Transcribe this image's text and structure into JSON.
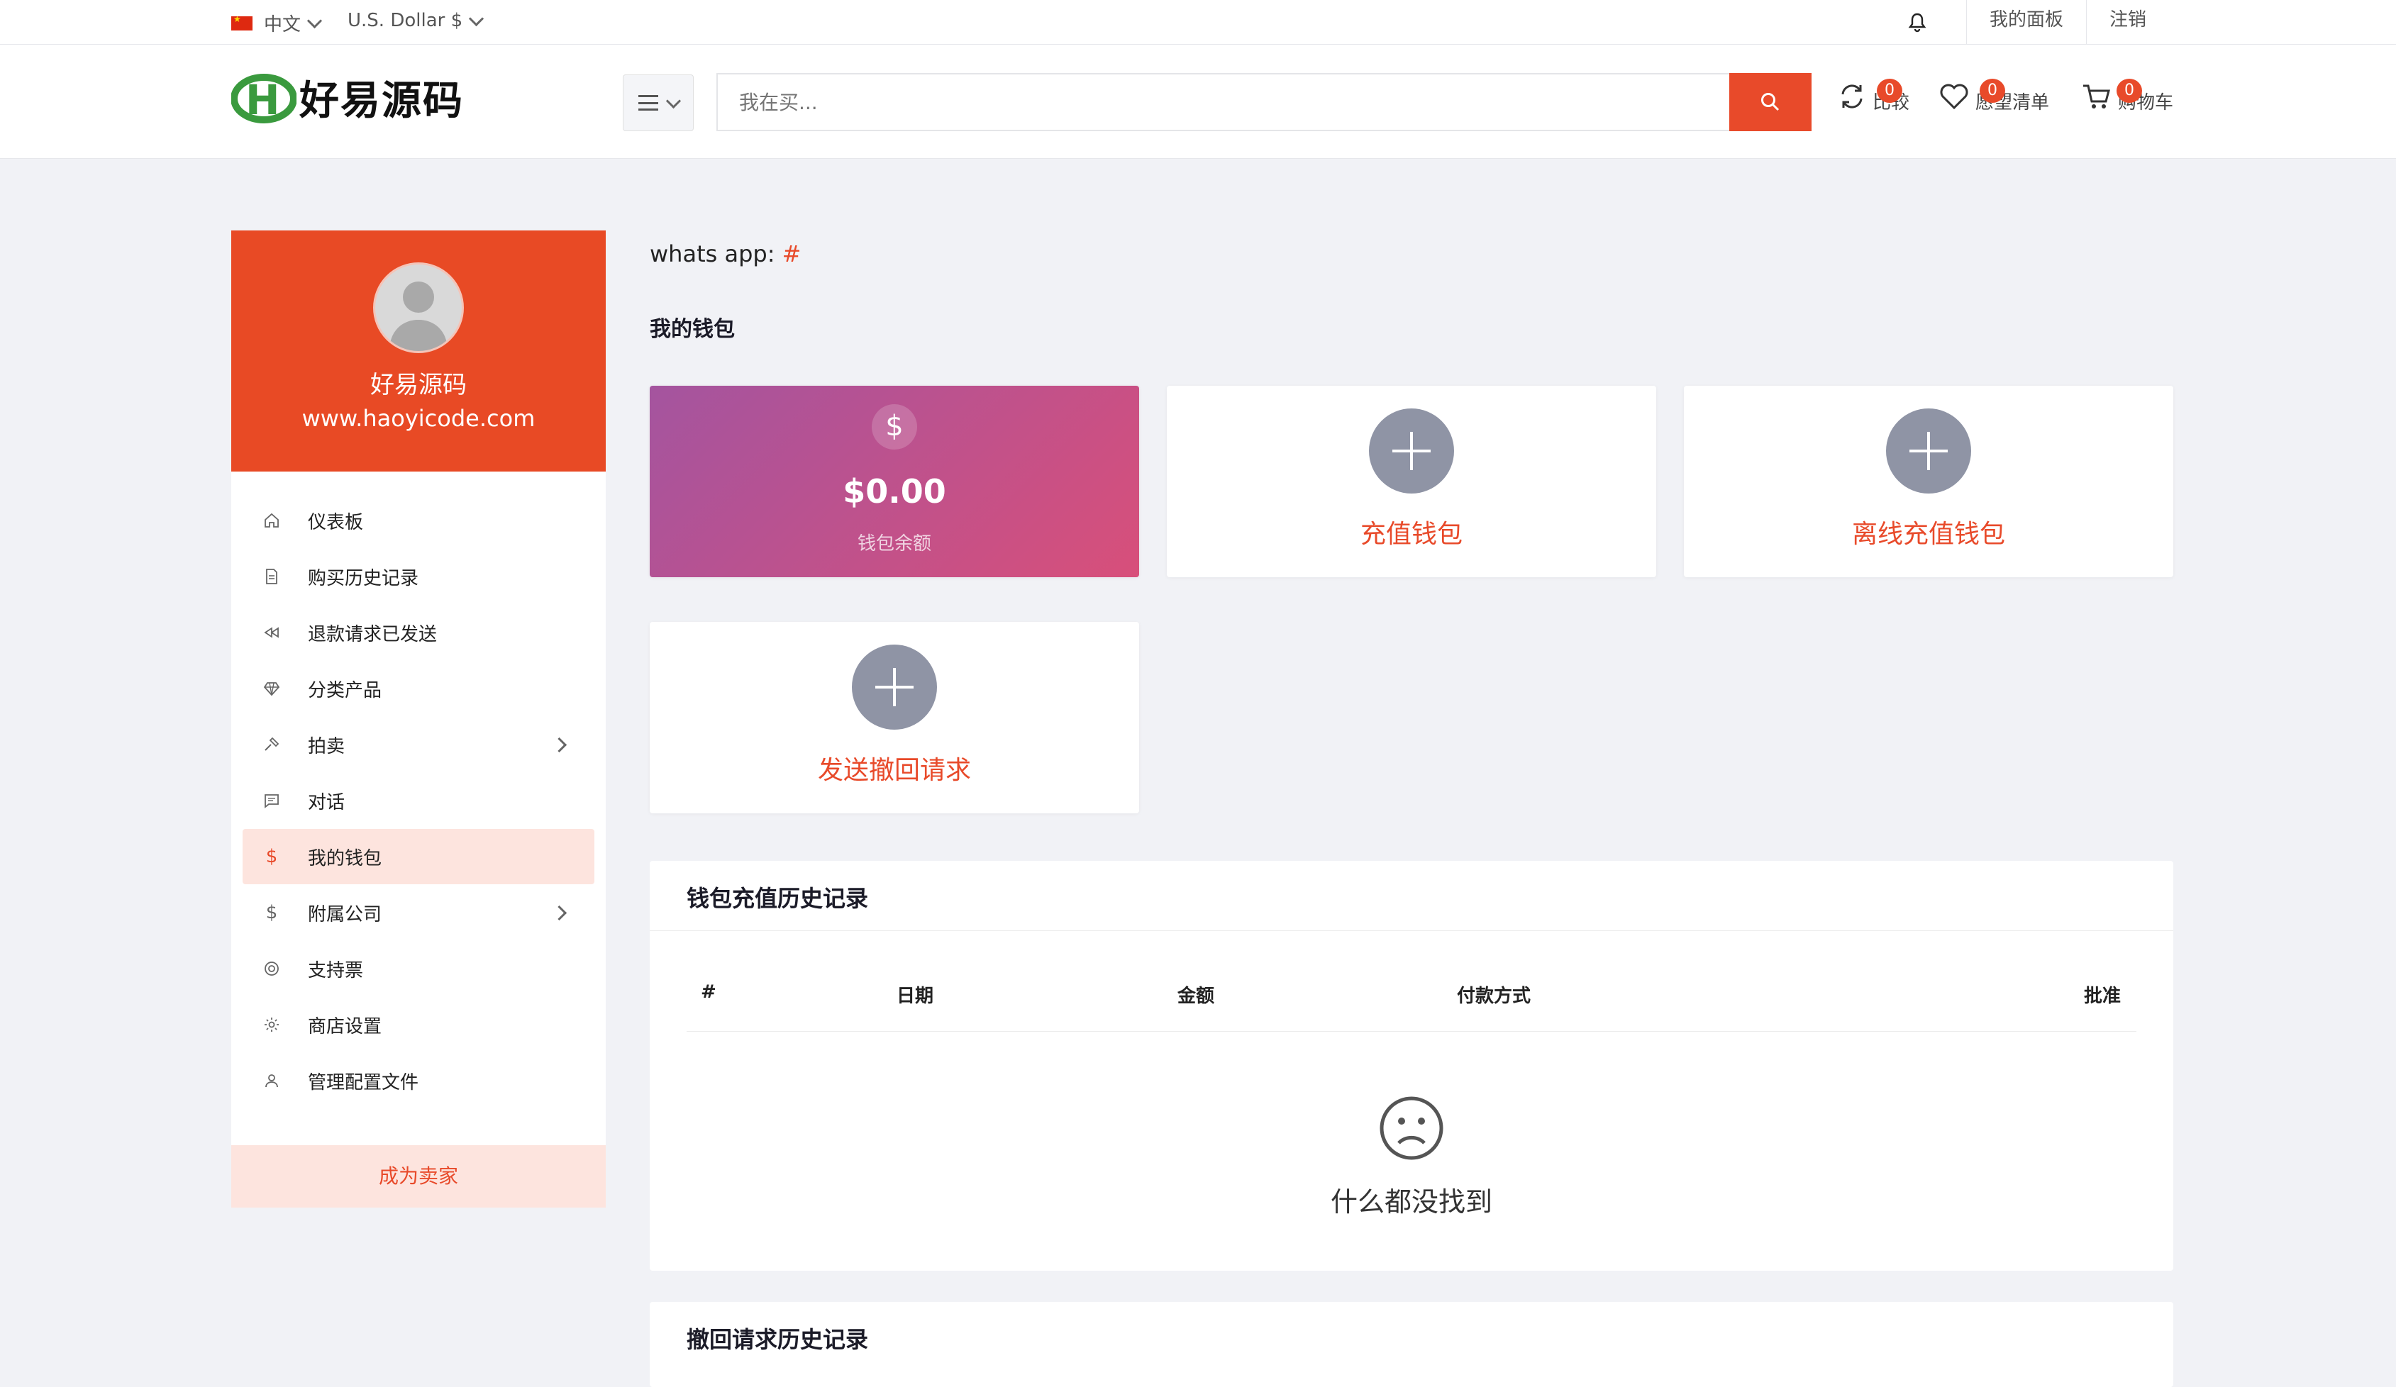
{
  "topbar": {
    "language": "中文",
    "currency": "U.S. Dollar $",
    "dashboard_link": "我的面板",
    "logout_link": "注销"
  },
  "header": {
    "logo_text": "好易源码",
    "search_placeholder": "我在买...",
    "compare": {
      "label": "比较",
      "count": "0"
    },
    "wishlist": {
      "label": "愿望清单",
      "count": "0"
    },
    "cart": {
      "label": "购物车",
      "count": "0"
    }
  },
  "sidebar": {
    "profile": {
      "name": "好易源码",
      "url": "www.haoyicode.com"
    },
    "items": [
      {
        "label": "仪表板",
        "icon": "home-icon"
      },
      {
        "label": "购买历史记录",
        "icon": "file-icon"
      },
      {
        "label": "退款请求已发送",
        "icon": "rewind-icon"
      },
      {
        "label": "分类产品",
        "icon": "diamond-icon"
      },
      {
        "label": "拍卖",
        "icon": "gavel-icon"
      },
      {
        "label": "对话",
        "icon": "chat-icon"
      },
      {
        "label": "我的钱包",
        "icon": "dollar-icon"
      },
      {
        "label": "附属公司",
        "icon": "dollar-icon"
      },
      {
        "label": "支持票",
        "icon": "support-icon"
      },
      {
        "label": "商店设置",
        "icon": "gear-icon"
      },
      {
        "label": "管理配置文件",
        "icon": "user-icon"
      }
    ],
    "become_seller": "成为卖家"
  },
  "main": {
    "whatsapp_label": "whats app:",
    "whatsapp_value": "#",
    "wallet_title": "我的钱包",
    "balance": {
      "symbol": "$",
      "amount": "$0.00",
      "caption": "钱包余额"
    },
    "recharge": "充值钱包",
    "offline_recharge": "离线充值钱包",
    "withdraw_request": "发送撤回请求",
    "recharge_history": {
      "title": "钱包充值历史记录",
      "columns": [
        "#",
        "日期",
        "金额",
        "付款方式",
        "批准"
      ],
      "empty_text": "什么都没找到"
    },
    "withdraw_history": {
      "title": "撤回请求历史记录"
    }
  },
  "colors": {
    "accent": "#e84a2a",
    "balance_gradient_start": "#a4549f",
    "balance_gradient_end": "#d84f7a"
  }
}
